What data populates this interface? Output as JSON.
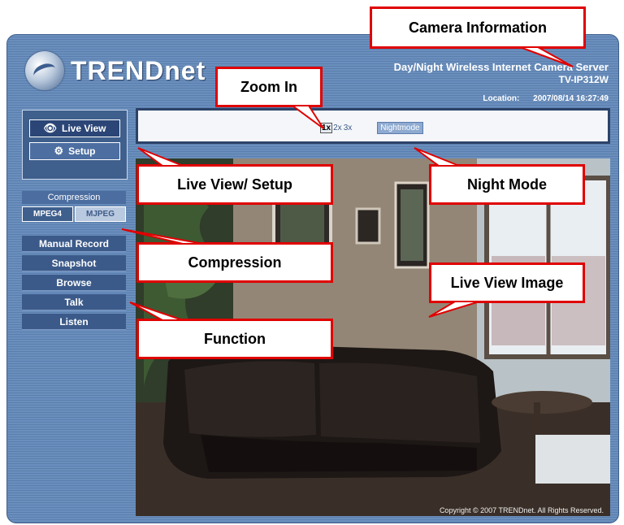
{
  "brand": {
    "name": "TRENDnet"
  },
  "camera": {
    "title": "Day/Night Wireless Internet Camera Server",
    "model": "TV-IP312W",
    "location_label": "Location:",
    "timestamp": "2007/08/14 16:27:49"
  },
  "nav": {
    "live_view": "Live View",
    "setup": "Setup"
  },
  "compression": {
    "header": "Compression",
    "options": [
      "MPEG4",
      "MJPEG"
    ],
    "selected": "MPEG4"
  },
  "functions": [
    "Manual Record",
    "Snapshot",
    "Browse",
    "Talk",
    "Listen"
  ],
  "zoom": {
    "levels": [
      "1x",
      "2x",
      "3x"
    ],
    "selected": "1x",
    "nightmode": "Nightmode"
  },
  "copyright": "Copyright © 2007 TRENDnet. All Rights Reserved.",
  "callouts": {
    "camera_info": "Camera Information",
    "zoom_in": "Zoom In",
    "live_view_setup": "Live View/ Setup",
    "night_mode": "Night Mode",
    "compression": "Compression",
    "live_view_image": "Live View Image",
    "function": "Function"
  },
  "colors": {
    "callout_border": "#e00000",
    "panel_bg": "#5a7fae",
    "button_bg": "#3b5a89"
  }
}
